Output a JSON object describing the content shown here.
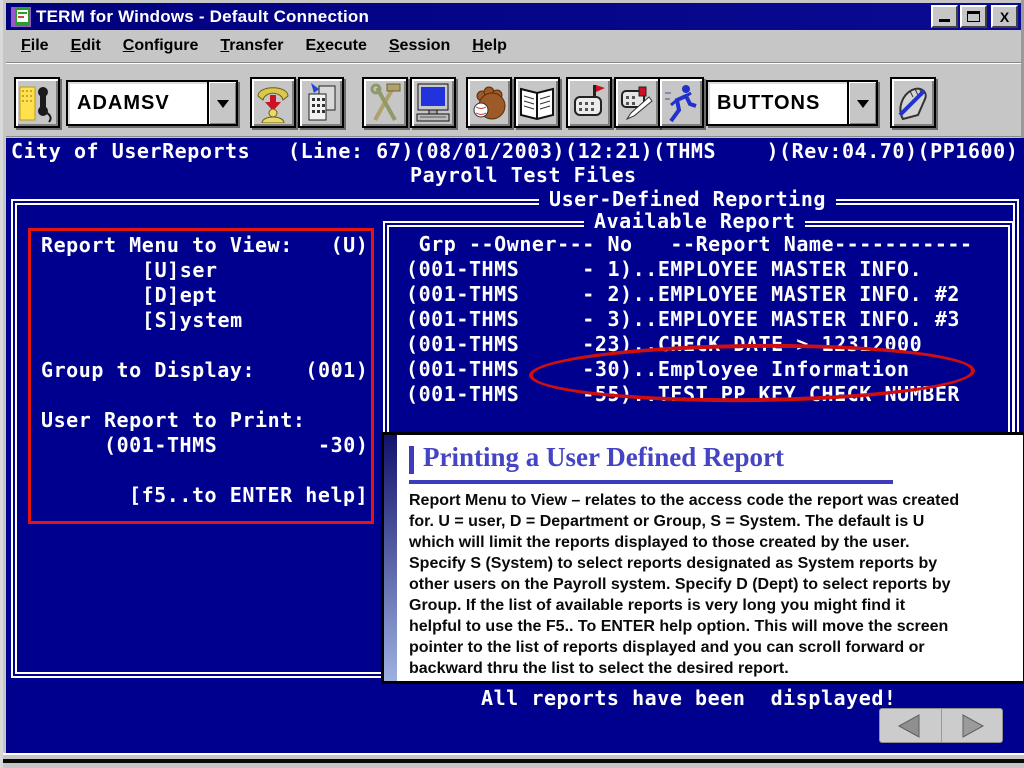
{
  "window": {
    "title": "TERM for Windows - Default Connection",
    "close_glyph": "X"
  },
  "menu": {
    "items": [
      {
        "label": "File",
        "u": 0
      },
      {
        "label": "Edit",
        "u": 0
      },
      {
        "label": "Configure",
        "u": 0
      },
      {
        "label": "Transfer",
        "u": 0
      },
      {
        "label": "Execute",
        "u": 1
      },
      {
        "label": "Session",
        "u": 0
      },
      {
        "label": "Help",
        "u": 0
      }
    ]
  },
  "toolbar": {
    "session_select": {
      "value": "ADAMSV"
    },
    "buttons_select": {
      "value": "BUTTONS"
    },
    "icon_names": [
      "connect-phone",
      "hangup-phone",
      "dial-keypad",
      "setup-tools",
      "terminal-monitor",
      "capture-glove",
      "log-book",
      "mail-receive",
      "mail-send",
      "run-script",
      "edit-buttons-pen"
    ]
  },
  "terminal": {
    "header_line": "City of UserReports   (Line: 67)(08/01/2003)(12:21)(THMS    )(Rev:04.70)(PP1600)",
    "subtitle": "Payroll Test Files",
    "main_box_title": "User-Defined Reporting",
    "left_panel": {
      "menu_prompt": "Report Menu to View:   (U)",
      "opt_user": "[U]ser",
      "opt_dept": "[D]ept",
      "opt_system": "[S]ystem",
      "group_prompt": "Group to Display:    (001)",
      "print_prompt": "User Report to Print:",
      "print_value": "(001-THMS        -30)",
      "help_hint": "[f5..to ENTER help]"
    },
    "report_panel": {
      "title": "Available Report",
      "header_row": " Grp --Owner--- No   --Report Name-----------",
      "rows": [
        "(001-THMS     - 1)..EMPLOYEE MASTER INFO.",
        "(001-THMS     - 2)..EMPLOYEE MASTER INFO. #2",
        "(001-THMS     - 3)..EMPLOYEE MASTER INFO. #3",
        "(001-THMS     -23)..CHECK DATE > 12312000",
        "(001-THMS     -30)..Employee Information",
        "(001-THMS     -55)..TEST PP KEY CHECK NUMBER"
      ]
    },
    "status_message": "All reports have been  displayed!"
  },
  "note": {
    "title": "Printing a User Defined Report",
    "body_lines": [
      "Report Menu to View – relates to the access code the report was created",
      "for.   U = user, D = Department or Group, S = System.  The default is U",
      "which will limit the reports displayed to those created by the user.",
      "Specify S (System) to select reports designated as System reports by",
      "other users on the Payroll system.  Specify D (Dept) to select reports by",
      "Group.  If the list of available reports is very long you might find it",
      "helpful to use the F5.. To ENTER help option.  This will move the screen",
      "pointer to the list of reports displayed and you can scroll forward or",
      "backward thru the list to select the desired report."
    ]
  },
  "colors": {
    "terminal_bg": "#00008f",
    "titlebar_bg": "#00007e",
    "annotation_red": "#e41414",
    "note_accent_blue": "#3d3dbb"
  }
}
